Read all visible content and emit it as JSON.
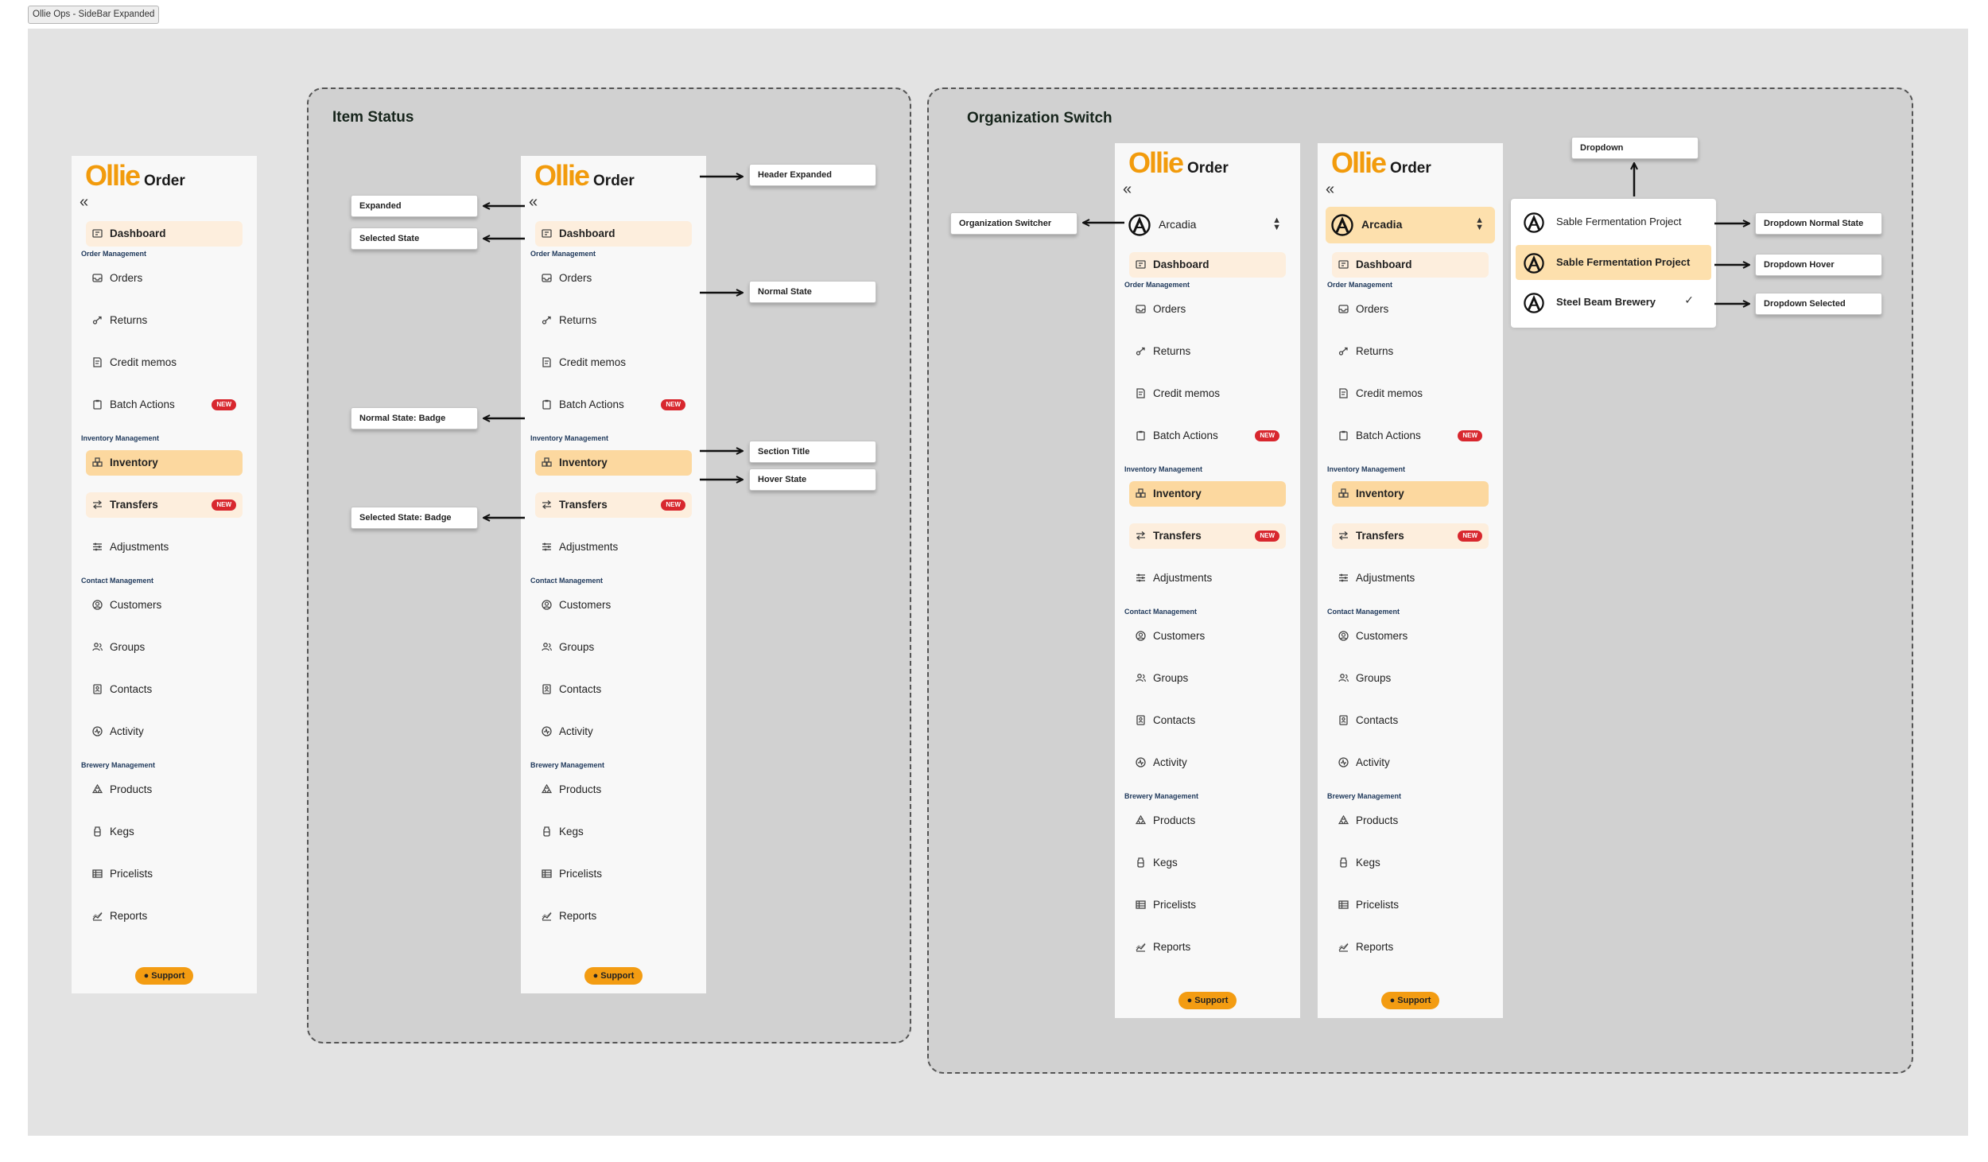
{
  "page_tab": "Ollie Ops - SideBar Expanded",
  "groups": {
    "item_status": "Item Status",
    "org_switch": "Organization Switch"
  },
  "logo": {
    "mark": "Ollie",
    "text": "Order"
  },
  "support_label": "Support",
  "badge_label": "NEW",
  "sections": {
    "order": "Order Management",
    "inventory": "Inventory Management",
    "contact": "Contact Management",
    "brewery": "Brewery Management"
  },
  "nav": {
    "dashboard": "Dashboard",
    "orders": "Orders",
    "returns": "Returns",
    "credit_memos": "Credit memos",
    "batch_actions": "Batch Actions",
    "inventory": "Inventory",
    "transfers": "Transfers",
    "adjustments": "Adjustments",
    "customers": "Customers",
    "groups": "Groups",
    "contacts": "Contacts",
    "activity": "Activity",
    "products": "Products",
    "kegs": "Kegs",
    "pricelists": "Pricelists",
    "reports": "Reports"
  },
  "org_switcher": {
    "current": "Arcadia"
  },
  "dropdown": {
    "items": [
      "Sable Fermentation Project",
      "Sable Fermentation Project",
      "Steel Beam Brewery"
    ]
  },
  "annotations": {
    "expanded": "Expanded",
    "selected_state": "Selected State",
    "normal_state_badge": "Normal State: Badge",
    "selected_state_badge": "Selected State: Badge",
    "header_expanded": "Header Expanded",
    "normal_state": "Normal State",
    "section_title": "Section Title",
    "hover_state": "Hover State",
    "organization_switcher": "Organization Switcher",
    "dropdown": "Dropdown",
    "dropdown_normal": "Dropdown Normal State",
    "dropdown_hover": "Dropdown Hover",
    "dropdown_selected": "Dropdown Selected"
  },
  "colors": {
    "brand": "#f29b0c",
    "selected_bg": "#fdeedd",
    "hover_bg": "#fcd89f",
    "badge": "#d8272e",
    "section_title": "#203a5c"
  },
  "icons": {
    "dashboard": "dashboard-icon",
    "orders": "inbox-icon",
    "returns": "return-icon",
    "credit_memos": "receipt-icon",
    "batch_actions": "clipboard-icon",
    "inventory": "boxes-icon",
    "transfers": "arrows-swap-icon",
    "adjustments": "sliders-icon",
    "customers": "user-circle-icon",
    "groups": "users-icon",
    "contacts": "contact-card-icon",
    "activity": "activity-icon",
    "products": "products-icon",
    "kegs": "keg-icon",
    "pricelists": "table-icon",
    "reports": "chart-icon"
  }
}
